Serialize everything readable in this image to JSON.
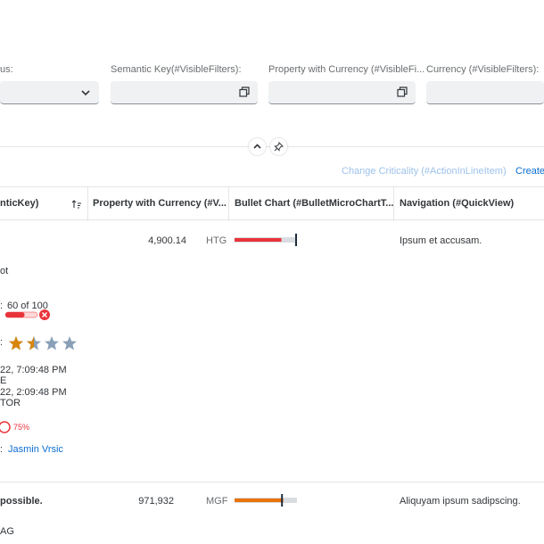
{
  "filters": [
    {
      "label": "us:",
      "value": ""
    },
    {
      "label": "Semantic Key(#VisibleFilters):",
      "value": ""
    },
    {
      "label": "Property with Currency (#VisibleFi...",
      "value": ""
    },
    {
      "label": "Currency (#VisibleFilters):",
      "value": ""
    }
  ],
  "toolbar": {
    "change_criticality": "Change Criticality (#ActionInLineItem)",
    "create": "Create"
  },
  "table": {
    "headers": [
      "nticKey)",
      "Property with Currency (#V...",
      "Bullet Chart (#BulletMicroChartT...",
      "Navigation (#QuickView)"
    ],
    "rows": [
      {
        "amount": "4,900.14",
        "currency": "HTG",
        "navigation": "Ipsum et accusam.",
        "fragment_a": "ot",
        "progress_text": "60 of 100",
        "progress_value": 0.6,
        "rating_label": ":",
        "rating_value": 1.5,
        "rating_max": 5,
        "date_line_1": "22, 7:09:48 PM",
        "date_line_1_sub": "E",
        "date_line_2": "22, 2:09:48 PM",
        "date_line_2_sub": "TOR",
        "radial_value": "75%",
        "contact_label": ":",
        "contact_name": "Jasmin Vrsic",
        "bullet_actual": 0.75,
        "bullet_target": 1.0,
        "bullet_color": "#e9333a"
      },
      {
        "title": "possible.",
        "amount": "971,932",
        "currency": "MGF",
        "navigation": "Aliquyam ipsum sadipscing.",
        "fragment_b": "AG",
        "bullet_actual": 0.78,
        "bullet_target": 0.76,
        "bullet_color": "#e9730c"
      }
    ]
  },
  "colors": {
    "accent": "#0a6ed1",
    "negative": "#e9333a",
    "critical": "#e9730c",
    "star_filled": "#d7850d",
    "star_empty": "#8aa0b8"
  },
  "icons": {
    "value_help": "value-help-icon",
    "dropdown": "chevron-down-icon",
    "collapse": "chevron-up-icon",
    "pin": "pin-icon",
    "sort": "sort-ascending-icon",
    "error": "error-icon",
    "star": "star-icon"
  }
}
